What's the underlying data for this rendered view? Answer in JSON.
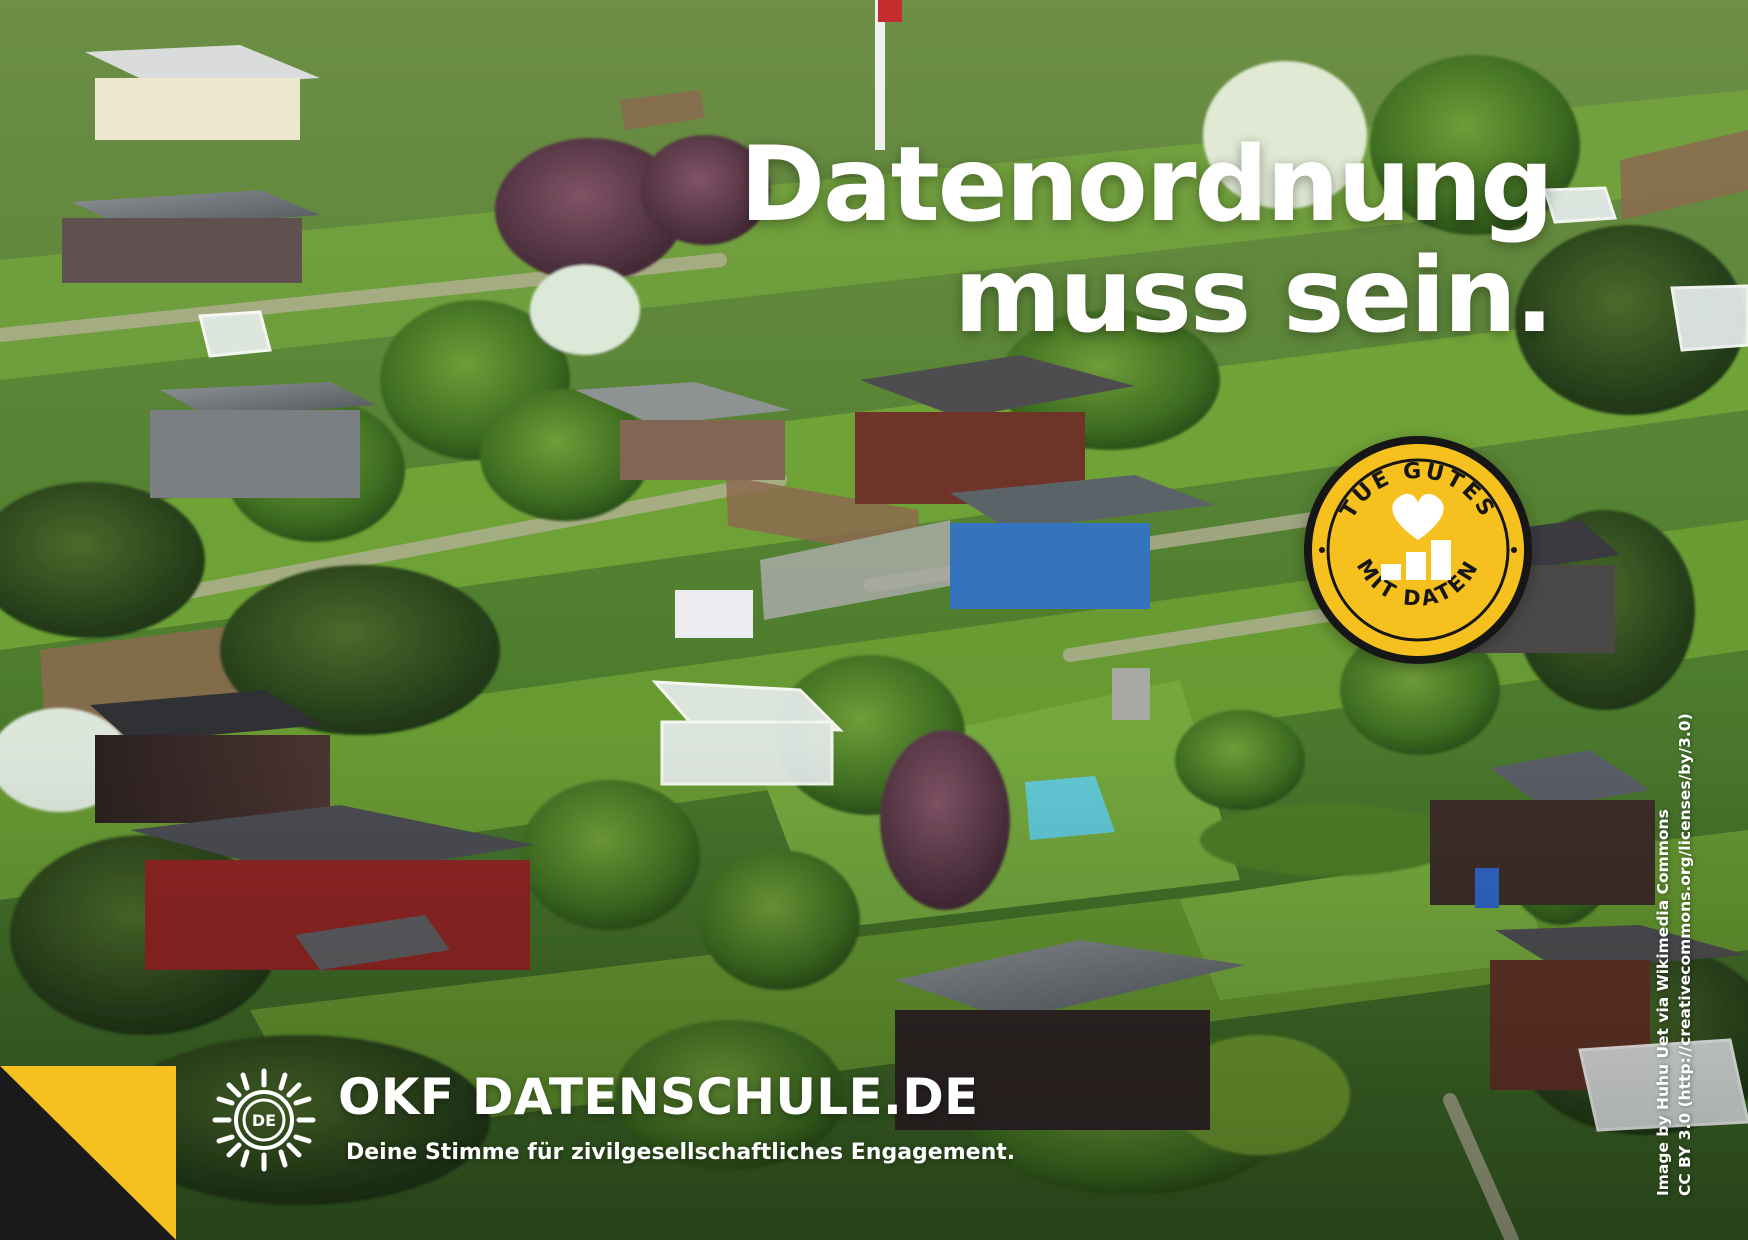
{
  "image": {
    "description_tags": [
      "aerial-view",
      "allotment-gardens",
      "garden-sheds",
      "greenhouses",
      "trees",
      "lawns"
    ]
  },
  "headline": {
    "line1": "Datenordnung",
    "line2": "muss sein."
  },
  "badge": {
    "top_text": "TUE GUTES",
    "bottom_text": "MIT DATEN",
    "icon": "heart-with-rising-steps-icon",
    "color": "#f6c11e",
    "border_color": "#161616"
  },
  "branding": {
    "logo_text": "DE",
    "name": "OKF DATENSCHULE.DE",
    "tagline": "Deine Stimme für zivilgesellschaftliches Engagement."
  },
  "credit": {
    "line1": "Image by Huhu Uet via Wikimedia Commons",
    "line2": "CC BY 3.0 (http://creativecommons.org/licenses/by/3.0)"
  },
  "colors": {
    "accent_yellow": "#f6c11e",
    "dark": "#1a1a1a",
    "text": "#ffffff"
  }
}
